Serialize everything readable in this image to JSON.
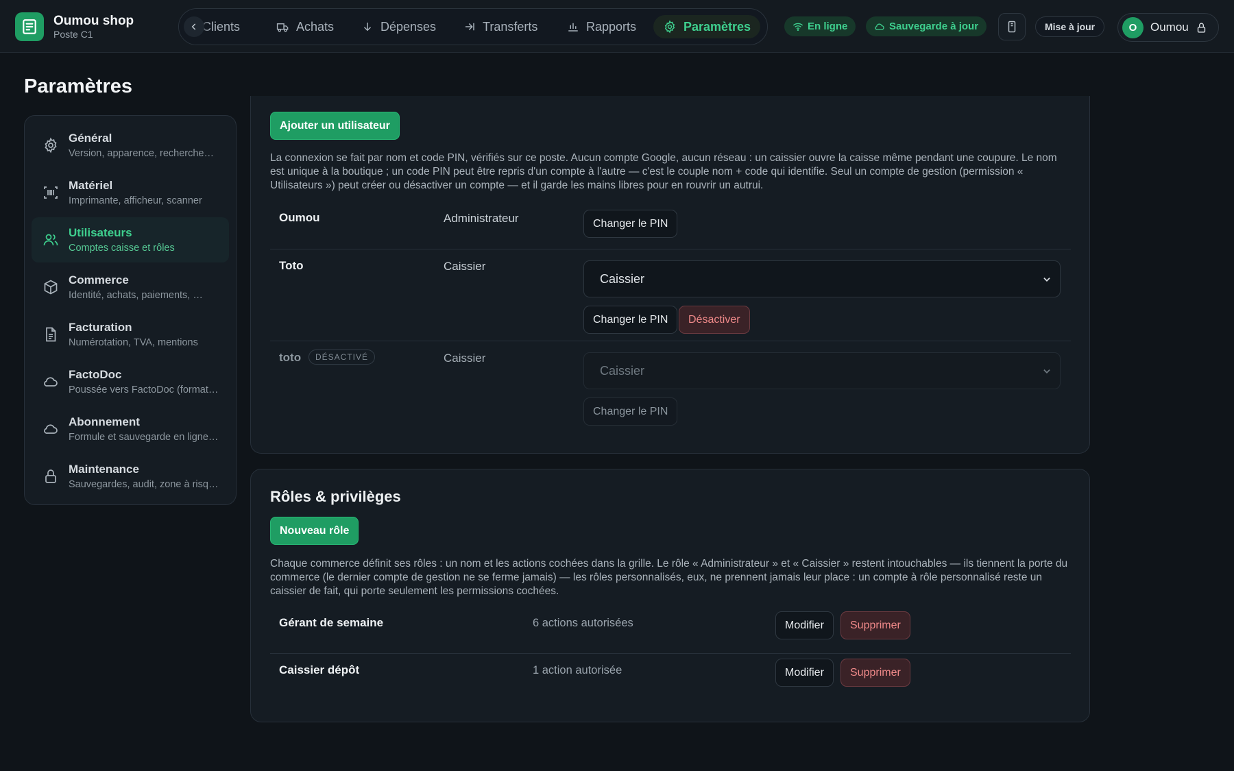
{
  "app": {
    "shop_name": "Oumou shop",
    "station": "Poste C1"
  },
  "nav": {
    "items": [
      "Clients",
      "Achats",
      "Dépenses",
      "Transferts",
      "Rapports",
      "Paramètres"
    ],
    "active": "Paramètres"
  },
  "status": {
    "online": "En ligne",
    "backup": "Sauvegarde à jour"
  },
  "header": {
    "update_label": "Mise à jour",
    "user_initial": "O",
    "user_name": "Oumou"
  },
  "page": {
    "title": "Paramètres"
  },
  "sidebar": {
    "items": [
      {
        "title": "Général",
        "subtitle": "Version, apparence, recherche…",
        "icon": "gear-icon"
      },
      {
        "title": "Matériel",
        "subtitle": "Imprimante, afficheur, scanner",
        "icon": "barcode-scan-icon"
      },
      {
        "title": "Utilisateurs",
        "subtitle": "Comptes caisse et rôles",
        "icon": "users-icon"
      },
      {
        "title": "Commerce",
        "subtitle": "Identité, achats, paiements, …",
        "icon": "box-icon"
      },
      {
        "title": "Facturation",
        "subtitle": "Numérotation, TVA, mentions",
        "icon": "document-icon"
      },
      {
        "title": "FactoDoc",
        "subtitle": "Poussée vers FactoDoc (format…",
        "icon": "cloud-icon"
      },
      {
        "title": "Abonnement",
        "subtitle": "Formule et sauvegarde en ligne…",
        "icon": "cloud-icon"
      },
      {
        "title": "Maintenance",
        "subtitle": "Sauvegardes, audit, zone à risque…",
        "icon": "lock-icon"
      }
    ],
    "active": "Utilisateurs"
  },
  "users": {
    "add_button": "Ajouter un utilisateur",
    "description": "La connexion se fait par nom et code PIN, vérifiés sur ce poste. Aucun compte Google, aucun réseau : un caissier ouvre la caisse même pendant une coupure. Le nom est unique à la boutique ; un code PIN peut être repris d'un compte à l'autre — c'est le couple nom + code qui identifie. Seul un compte de gestion (permission « Utilisateurs ») peut créer ou désactiver un compte — et il garde les mains libres pour en rouvrir un autrui.",
    "change_pin_label": "Changer le PIN",
    "deactivate_label": "Désactiver",
    "disabled_badge": "DÉSACTIVÉ",
    "rows": [
      {
        "name": "Oumou",
        "role": "Administrateur"
      },
      {
        "name": "Toto",
        "role": "Caissier",
        "select_value": "Caissier"
      },
      {
        "name": "toto",
        "role": "Caissier",
        "select_value": "Caissier",
        "disabled": true
      }
    ]
  },
  "roles": {
    "title": "Rôles & privilèges",
    "new_button": "Nouveau rôle",
    "description": "Chaque commerce définit ses rôles : un nom et les actions cochées dans la grille. Le rôle « Administrateur » et « Caissier » restent intouchables — ils tiennent la porte du commerce (le dernier compte de gestion ne se ferme jamais) — les rôles personnalisés, eux, ne prennent jamais leur place : un compte à rôle personnalisé reste un caissier de fait, qui porte seulement les permissions cochées.",
    "edit_label": "Modifier",
    "delete_label": "Supprimer",
    "rows": [
      {
        "name": "Gérant de semaine",
        "permissions": "6 actions autorisées"
      },
      {
        "name": "Caissier dépôt",
        "permissions": "1 action autorisée"
      }
    ]
  },
  "colors": {
    "accent": "#3ecf8e",
    "primary_button": "#1f9d63",
    "danger": "#f08a8a",
    "background": "#0f1419"
  }
}
